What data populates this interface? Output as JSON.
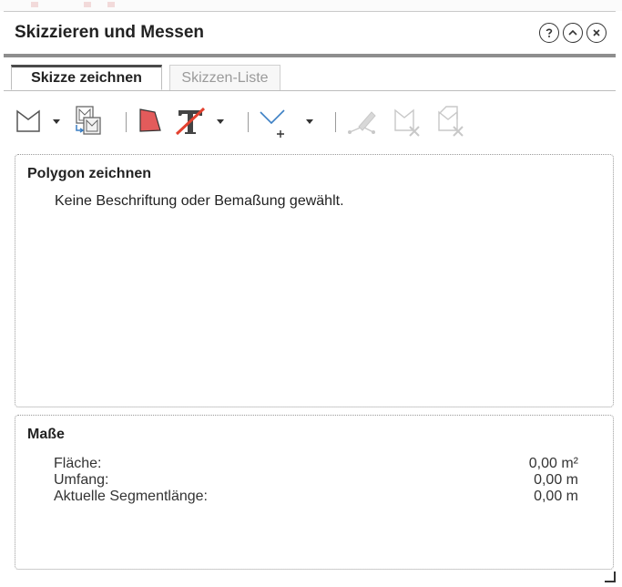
{
  "window": {
    "title": "Skizzieren und Messen"
  },
  "tabs": [
    {
      "label": "Skizze zeichnen",
      "active": true
    },
    {
      "label": "Skizzen-Liste",
      "active": false
    }
  ],
  "toolbar": {
    "icons": [
      "polygon-select-icon",
      "copy-sketch-icon",
      "fill-color-icon",
      "text-strike-icon",
      "add-vertex-icon",
      "edit-vertices-icon",
      "delete-shape-icon",
      "delete-all-icon"
    ],
    "colors": {
      "fill": "#e35b5b",
      "strike": "#e3412f",
      "disabled": "#c8c8c8"
    }
  },
  "drawing_section": {
    "title": "Polygon zeichnen",
    "message": "Keine Beschriftung oder Bemaßung gewählt."
  },
  "measures_section": {
    "title": "Maße",
    "rows": [
      {
        "label": "Fläche:",
        "value": "0,00 m²"
      },
      {
        "label": "Umfang:",
        "value": "0,00 m"
      },
      {
        "label": "Aktuelle Segmentlänge:",
        "value": "0,00 m"
      }
    ]
  }
}
